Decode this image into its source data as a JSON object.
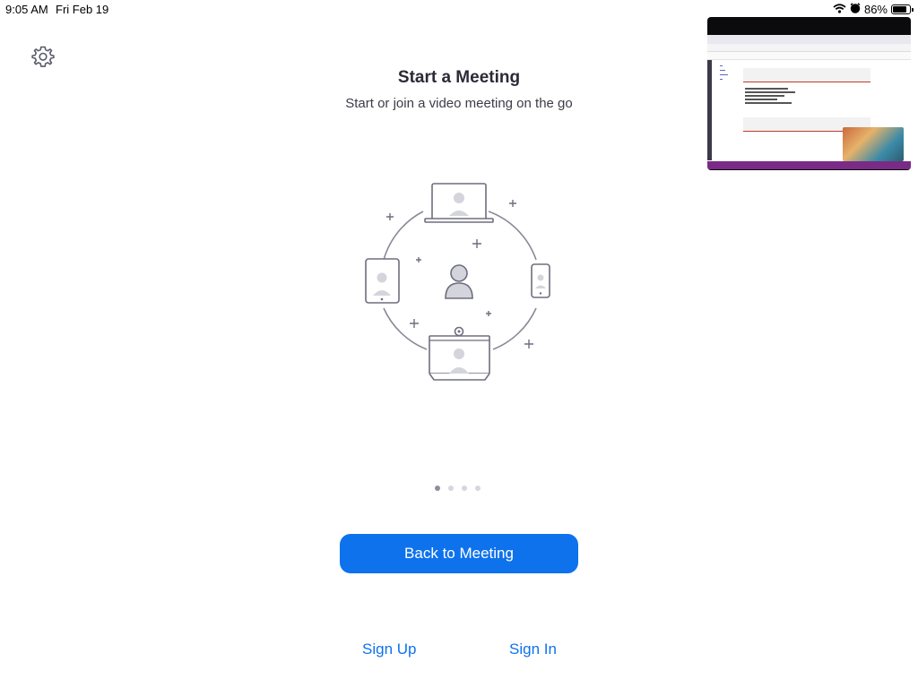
{
  "status_bar": {
    "time": "9:05 AM",
    "date": "Fri Feb 19",
    "battery": "86%",
    "battery_level": 0.86
  },
  "main": {
    "title": "Start a Meeting",
    "subtitle": "Start or join a video meeting on the go"
  },
  "pager": {
    "count": 4,
    "active_index": 0
  },
  "buttons": {
    "back_to_meeting": "Back to Meeting",
    "sign_up": "Sign Up",
    "sign_in": "Sign In"
  },
  "colors": {
    "accent": "#0e72ed",
    "illustration_stroke": "#6e6e7e",
    "illustration_fill": "#d4d4dc"
  },
  "icons": {
    "settings": "gear-icon",
    "wifi": "wifi-icon",
    "alarm": "alarm-icon",
    "battery": "battery-icon"
  }
}
